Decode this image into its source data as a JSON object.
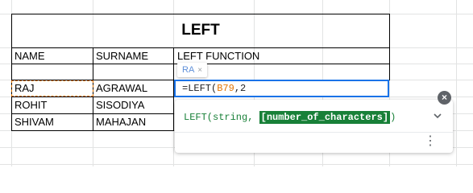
{
  "title": "LEFT",
  "headers": [
    "NAME",
    "SURNAME",
    "LEFT FUNCTION"
  ],
  "rows": [
    [
      "RAJ",
      "AGRAWAL"
    ],
    [
      "ROHIT",
      "SISODIYA"
    ],
    [
      "SHIVAM",
      "MAHAJAN"
    ]
  ],
  "chip": {
    "label": "RA",
    "close": "×"
  },
  "formula": {
    "prefix": "=LEFT(",
    "ref": "B79",
    "suffix": ",2"
  },
  "popup": {
    "signature_start": "LEFT(string, ",
    "signature_highlight": "[number_of_characters]",
    "signature_end": ")",
    "expand_icon": "chevron-down",
    "more_icon": "⋮",
    "close_icon": "×"
  }
}
